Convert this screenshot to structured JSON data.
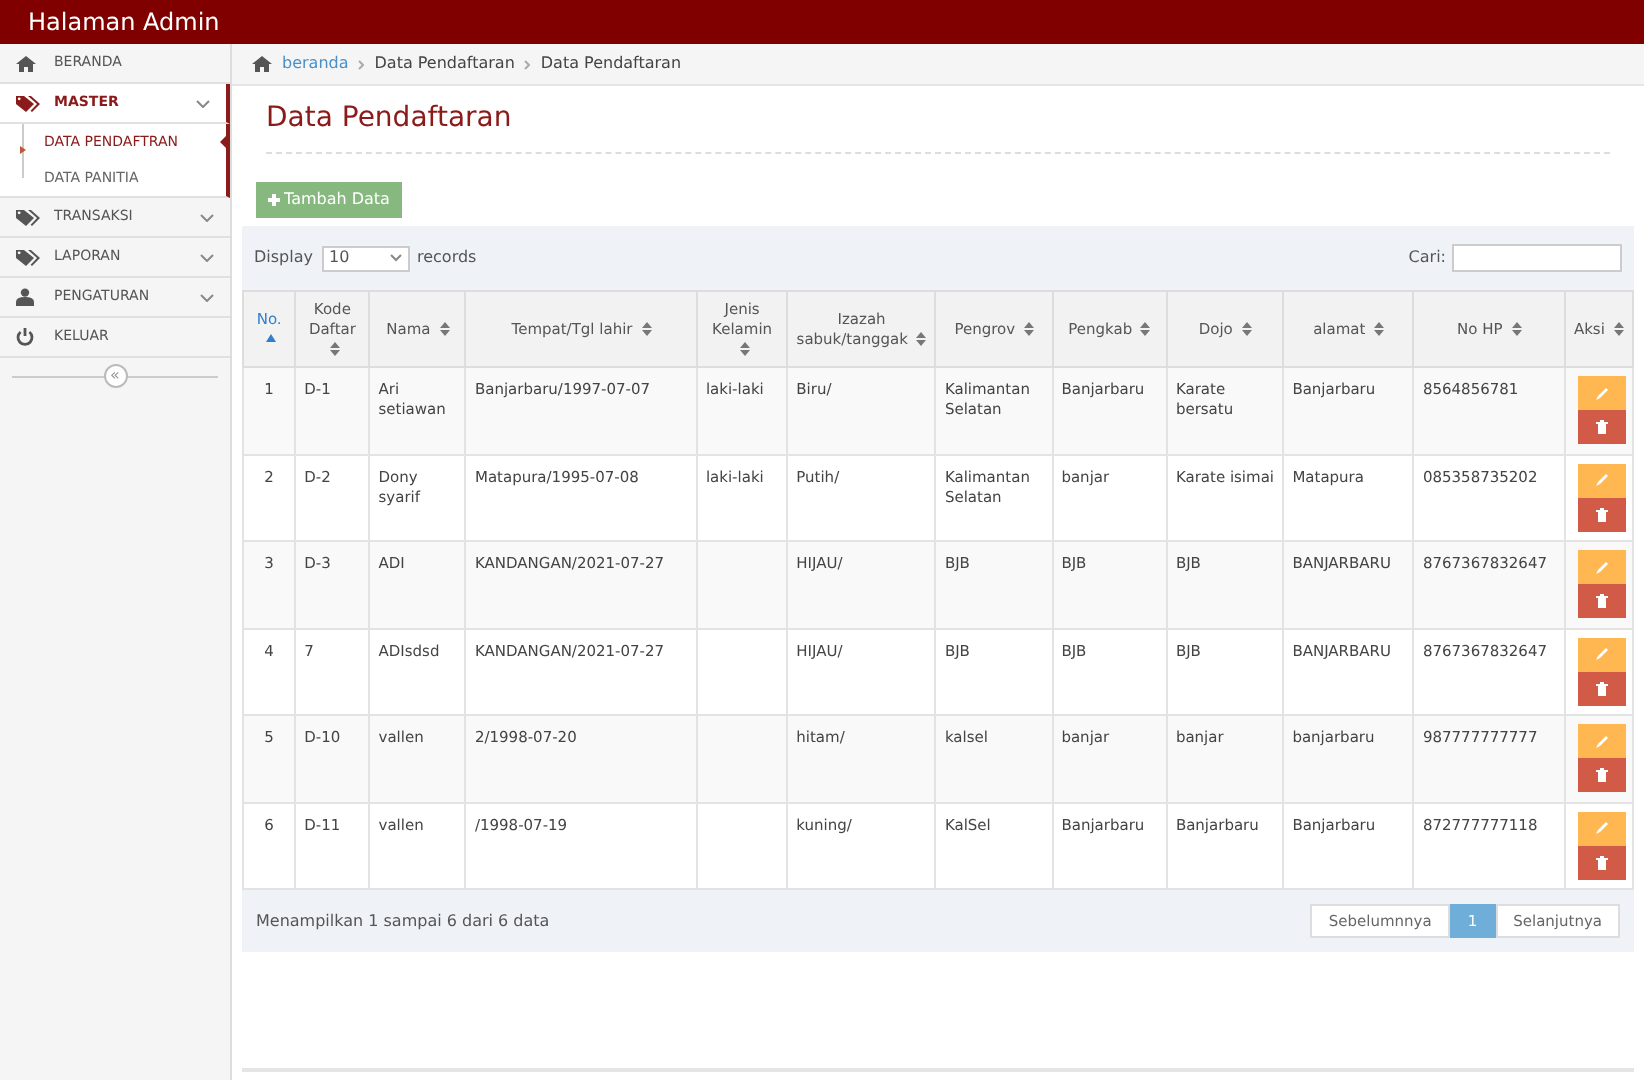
{
  "app_title": "Halaman Admin",
  "sidebar": {
    "items": [
      {
        "label": "BERANDA",
        "kind": "home",
        "selected": false
      },
      {
        "label": "MASTER",
        "kind": "tags",
        "expanded": true,
        "selected": true,
        "children": [
          {
            "label": "DATA PENDAFTRAN",
            "selected": true
          },
          {
            "label": "DATA PANITIA",
            "selected": false
          }
        ]
      },
      {
        "label": "TRANSAKSI",
        "kind": "tags",
        "selected": false,
        "has_children": true
      },
      {
        "label": "LAPORAN",
        "kind": "tags",
        "selected": false,
        "has_children": true
      },
      {
        "label": "PENGATURAN",
        "kind": "user",
        "selected": false,
        "has_children": true
      },
      {
        "label": "KELUAR",
        "kind": "power",
        "selected": false
      }
    ],
    "collapse_button": "«"
  },
  "breadcrumb": [
    {
      "label": "beranda",
      "kind": "link"
    },
    {
      "label": "Data Pendaftaran",
      "kind": "text"
    },
    {
      "label": "Data Pendaftaran",
      "kind": "text"
    }
  ],
  "page_title": "Data Pendaftaran",
  "add_button": "Tambah Data",
  "length_control": {
    "label": "Display",
    "value": "10",
    "suffix": "records"
  },
  "search": {
    "label": "Cari:"
  },
  "table": {
    "columns": [
      {
        "label": "No.",
        "sorted": true
      },
      {
        "label": "Kode Daftar",
        "sorted": false
      },
      {
        "label": "Nama",
        "sorted": false
      },
      {
        "label": "Tempat/Tgl lahir",
        "sorted": false
      },
      {
        "label": "Jenis Kelamin",
        "sorted": false
      },
      {
        "label": "Izazah sabuk/tanggak",
        "sorted": false
      },
      {
        "label": "Pengrov",
        "sorted": false
      },
      {
        "label": "Pengkab",
        "sorted": false
      },
      {
        "label": "Dojo",
        "sorted": false
      },
      {
        "label": "alamat",
        "sorted": false
      },
      {
        "label": "No HP",
        "sorted": false
      },
      {
        "label": "Aksi",
        "sorted": false
      }
    ],
    "rows": [
      [
        "1",
        "D-1",
        "Ari setiawan",
        "Banjarbaru/1997-07-07",
        "laki-laki",
        "Biru/",
        "Kalimantan Selatan",
        "Banjarbaru",
        "Karate bersatu",
        "Banjarbaru",
        "8564856781"
      ],
      [
        "2",
        "D-2",
        "Dony syarif",
        "Matapura/1995-07-08",
        "laki-laki",
        "Putih/",
        "Kalimantan Selatan",
        "banjar",
        "Karate isimai",
        "Matapura",
        "085358735202"
      ],
      [
        "3",
        "D-3",
        "ADI",
        "KANDANGAN/2021-07-27",
        "",
        "HIJAU/",
        "BJB",
        "BJB",
        "BJB",
        "BANJARBARU",
        "8767367832647"
      ],
      [
        "4",
        "7",
        "ADIsdsd",
        "KANDANGAN/2021-07-27",
        "",
        "HIJAU/",
        "BJB",
        "BJB",
        "BJB",
        "BANJARBARU",
        "8767367832647"
      ],
      [
        "5",
        "D-10",
        "vallen",
        "2/1998-07-20",
        "",
        "hitam/",
        "kalsel",
        "banjar",
        "banjar",
        "banjarbaru",
        "987777777777"
      ],
      [
        "6",
        "D-11",
        "vallen",
        "/1998-07-19",
        "",
        "kuning/",
        "KalSel",
        "Banjarbaru",
        "Banjarbaru",
        "Banjarbaru",
        "872777777118"
      ]
    ]
  },
  "info": "Menampilkan 1 sampai 6 dari 6 data",
  "pagination": [
    {
      "label": "Sebelumnnya",
      "selected": false
    },
    {
      "label": "1",
      "selected": true
    },
    {
      "label": "Selanjutnya",
      "selected": false
    }
  ]
}
